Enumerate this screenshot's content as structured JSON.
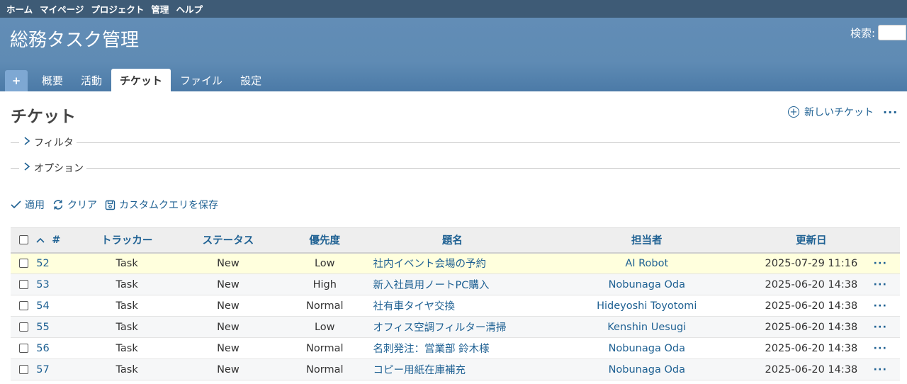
{
  "top_menu": [
    "ホーム",
    "マイページ",
    "プロジェクト",
    "管理",
    "ヘルプ"
  ],
  "header": {
    "project_title": "総務タスク管理",
    "search_label": "検索:"
  },
  "main_menu": {
    "new_label": "+",
    "tabs": [
      "概要",
      "活動",
      "チケット",
      "ファイル",
      "設定"
    ],
    "selected": "チケット"
  },
  "page": {
    "title": "チケット",
    "new_issue": "新しいチケット",
    "more": "···",
    "filter_label": "フィルタ",
    "option_label": "オプション"
  },
  "buttons": {
    "apply": "適用",
    "clear": "クリア",
    "save_query": "カスタムクエリを保存"
  },
  "table": {
    "columns": [
      "#",
      "トラッカー",
      "ステータス",
      "優先度",
      "題名",
      "担当者",
      "更新日"
    ],
    "sort_icon": "chevron-up-icon",
    "rows": [
      {
        "id": "52",
        "tracker": "Task",
        "status": "New",
        "priority": "Low",
        "subject": "社内イベント会場の予約",
        "assignee": "AI Robot",
        "updated": "2025-07-29 11:16",
        "highlight": true
      },
      {
        "id": "53",
        "tracker": "Task",
        "status": "New",
        "priority": "High",
        "subject": "新入社員用ノートPC購入",
        "assignee": "Nobunaga Oda",
        "updated": "2025-06-20 14:38"
      },
      {
        "id": "54",
        "tracker": "Task",
        "status": "New",
        "priority": "Normal",
        "subject": "社有車タイヤ交換",
        "assignee": "Hideyoshi Toyotomi",
        "updated": "2025-06-20 14:38"
      },
      {
        "id": "55",
        "tracker": "Task",
        "status": "New",
        "priority": "Low",
        "subject": "オフィス空調フィルター清掃",
        "assignee": "Kenshin Uesugi",
        "updated": "2025-06-20 14:38"
      },
      {
        "id": "56",
        "tracker": "Task",
        "status": "New",
        "priority": "Normal",
        "subject": "名刺発注：営業部 鈴木様",
        "assignee": "Nobunaga Oda",
        "updated": "2025-06-20 14:38"
      },
      {
        "id": "57",
        "tracker": "Task",
        "status": "New",
        "priority": "Normal",
        "subject": "コピー用紙在庫補充",
        "assignee": "Nobunaga Oda",
        "updated": "2025-06-20 14:38"
      }
    ],
    "row_menu": "···"
  },
  "colors": {
    "top_menu_bg": "#3e5b76",
    "header_bg": "#628db6",
    "link": "#1f6193",
    "highlight_row": "#ffffdd"
  }
}
